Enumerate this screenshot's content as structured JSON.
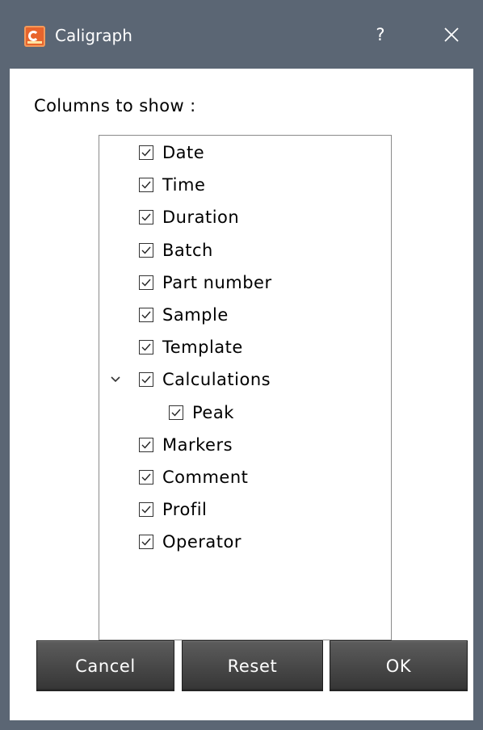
{
  "window": {
    "title": "Caligraph",
    "help_label": "?",
    "app_icon": "caligraph-app-icon",
    "close_icon": "close-icon"
  },
  "dialog": {
    "prompt": "Columns to show :",
    "columns": [
      {
        "label": "Date",
        "checked": true,
        "level": 0
      },
      {
        "label": "Time",
        "checked": true,
        "level": 0
      },
      {
        "label": "Duration",
        "checked": true,
        "level": 0
      },
      {
        "label": "Batch",
        "checked": true,
        "level": 0
      },
      {
        "label": "Part number",
        "checked": true,
        "level": 0
      },
      {
        "label": "Sample",
        "checked": true,
        "level": 0
      },
      {
        "label": "Template",
        "checked": true,
        "level": 0
      },
      {
        "label": "Calculations",
        "checked": true,
        "level": 0,
        "expanded": true
      },
      {
        "label": "Peak",
        "checked": true,
        "level": 1
      },
      {
        "label": "Markers",
        "checked": true,
        "level": 0
      },
      {
        "label": "Comment",
        "checked": true,
        "level": 0
      },
      {
        "label": "Profil",
        "checked": true,
        "level": 0
      },
      {
        "label": "Operator",
        "checked": true,
        "level": 0
      }
    ]
  },
  "buttons": {
    "cancel": "Cancel",
    "reset": "Reset",
    "ok": "OK"
  },
  "colors": {
    "titlebar": "#5b6674",
    "button_face": "#444444",
    "accent": "#e8642c"
  }
}
